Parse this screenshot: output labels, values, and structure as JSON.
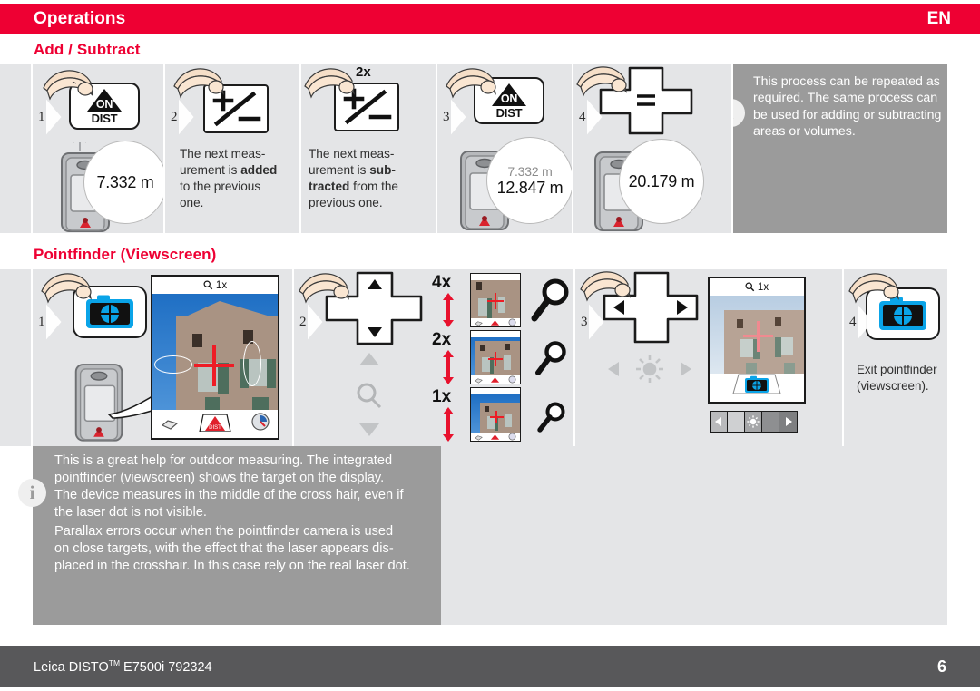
{
  "header": {
    "title": "Operations",
    "language": "EN",
    "accent_color": "#EE0033"
  },
  "sections": [
    {
      "id": "add-subtract",
      "title": "Add / Subtract"
    },
    {
      "id": "pointfinder",
      "title": "Pointfinder (Viewscreen)"
    }
  ],
  "add_subtract": {
    "steps": [
      {
        "number": "1",
        "key_icon": "on-dist-key-icon",
        "key_on_label": "ON",
        "key_dist_label": "DIST",
        "multiplier": "",
        "bubble_value": "7.332 m",
        "bubble_previous": "",
        "text_parts": []
      },
      {
        "number": "2",
        "key_icon": "plus-minus-key-icon",
        "multiplier": "",
        "text_parts": [
          {
            "t": "The next meas-",
            "b": false
          },
          {
            "t": "urement is ",
            "b": false
          },
          {
            "t": "added",
            "b": true
          },
          {
            "t": " to the previous one.",
            "b": false
          }
        ],
        "text_line1": "The next meas-",
        "text_line2_pre": "urement is ",
        "text_line2_bold": "added",
        "text_line3": "to the previous",
        "text_line4": "one."
      },
      {
        "number": "",
        "key_icon": "plus-minus-key-icon",
        "multiplier": "2x",
        "text_line1": "The next meas-",
        "text_line2_pre": "urement is ",
        "text_line2_bold": "sub-",
        "text_line3_bold": "tracted",
        "text_line3_post": " from the",
        "text_line4": "previous one."
      },
      {
        "number": "3",
        "key_icon": "on-dist-key-icon",
        "key_on_label": "ON",
        "key_dist_label": "DIST",
        "bubble_previous": "7.332 m",
        "bubble_value": "12.847 m"
      },
      {
        "number": "4",
        "key_icon": "equals-cross-key-icon",
        "bubble_value": "20.179 m"
      }
    ],
    "note": {
      "icon": "info-icon",
      "lines": [
        "This process can be repeated as",
        "required. The same process can",
        "be used for adding or subtracting",
        "areas or volumes."
      ]
    }
  },
  "pointfinder": {
    "steps": [
      {
        "number": "1",
        "key_icon": "pointfinder-camera-key-icon",
        "screen": {
          "zoom_label": "1x",
          "magnifier_icon": "magnifier-icon"
        },
        "softkeys": [
          "diamond-icon",
          "dist-triangle-icon",
          "compass-icon"
        ]
      },
      {
        "number": "2",
        "key_icon": "nav-pad-up-down-icon",
        "hint_icons": [
          "triangle-up-icon",
          "magnifier-icon",
          "triangle-down-icon"
        ],
        "zoom_levels": [
          {
            "label": "4x",
            "magnifier": "magnifier-large-icon"
          },
          {
            "label": "2x",
            "magnifier": "magnifier-medium-icon"
          },
          {
            "label": "1x",
            "magnifier": "magnifier-small-icon"
          }
        ]
      },
      {
        "number": "3",
        "key_icon": "nav-pad-left-right-icon",
        "hint_icons": [
          "arrow-left-icon",
          "brightness-icon",
          "arrow-right-icon"
        ],
        "screen": {
          "zoom_label": "1x",
          "magnifier_icon": "magnifier-icon"
        },
        "navstrip_icons": [
          "arrow-left-icon",
          "brightness-icon",
          "arrow-right-icon"
        ]
      },
      {
        "number": "4",
        "key_icon": "pointfinder-camera-key-icon",
        "text_line1": "Exit pointfinder",
        "text_line2": "(viewscreen)."
      }
    ],
    "note": {
      "icon": "info-icon",
      "paragraph1": [
        "This is a great help for outdoor measuring. The integrated",
        "pointfinder (viewscreen) shows the target on the display.",
        "The device measures in the middle of the cross hair, even if",
        "the laser dot is not visible."
      ],
      "paragraph2": [
        "Parallax errors occur when the pointfinder camera is used",
        "on close targets, with the effect that the laser appears dis-",
        "placed in the crosshair. In this case rely on the real laser dot."
      ]
    }
  },
  "footer": {
    "brand": "Leica DISTO",
    "trademark": "TM",
    "model": " E7500i 792324",
    "page": "6",
    "background": "#58585a"
  }
}
